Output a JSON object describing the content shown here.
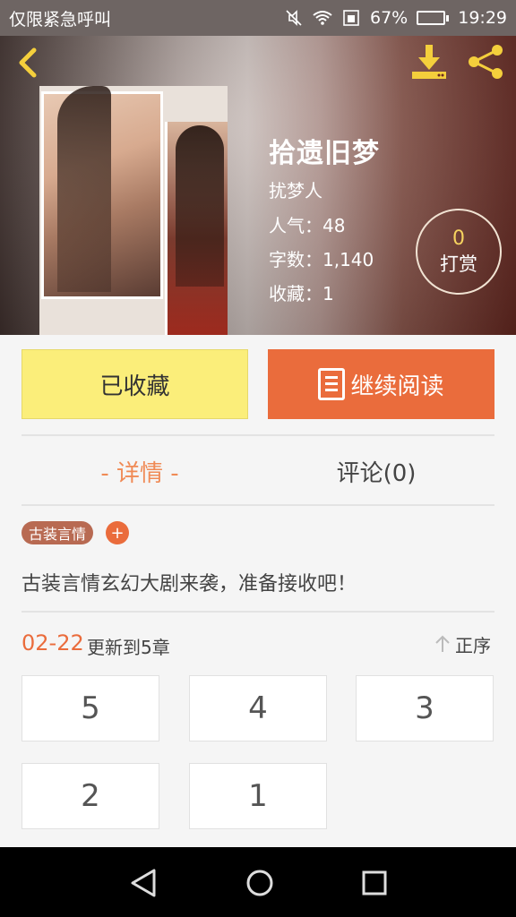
{
  "status_bar": {
    "carrier_text": "仅限紧急呼叫",
    "battery": "67%",
    "battery_level": 0.67,
    "time": "19:29"
  },
  "header": {
    "title": "拾遗旧梦",
    "author": "扰梦人",
    "popularity": "人气：48",
    "word_count": "字数：1,140",
    "favorites": "收藏：1",
    "tip_count": "0",
    "tip_label": "打赏"
  },
  "actions": {
    "collected_label": "已收藏",
    "continue_label": "继续阅读"
  },
  "tabs": {
    "details": "- 详情 -",
    "comments": "评论(0)"
  },
  "tags": {
    "genre": "古装言情",
    "add": "+"
  },
  "description": "古装言情玄幻大剧来袭，准备接收吧！",
  "update": {
    "date": "02-22",
    "text": "更新到5章",
    "sort_label": "正序"
  },
  "chapters": [
    "5",
    "4",
    "3",
    "2",
    "1"
  ],
  "colors": {
    "accent": "#ea6c3c",
    "collected_bg": "#fbee7a",
    "tab_active": "#f08a55"
  }
}
